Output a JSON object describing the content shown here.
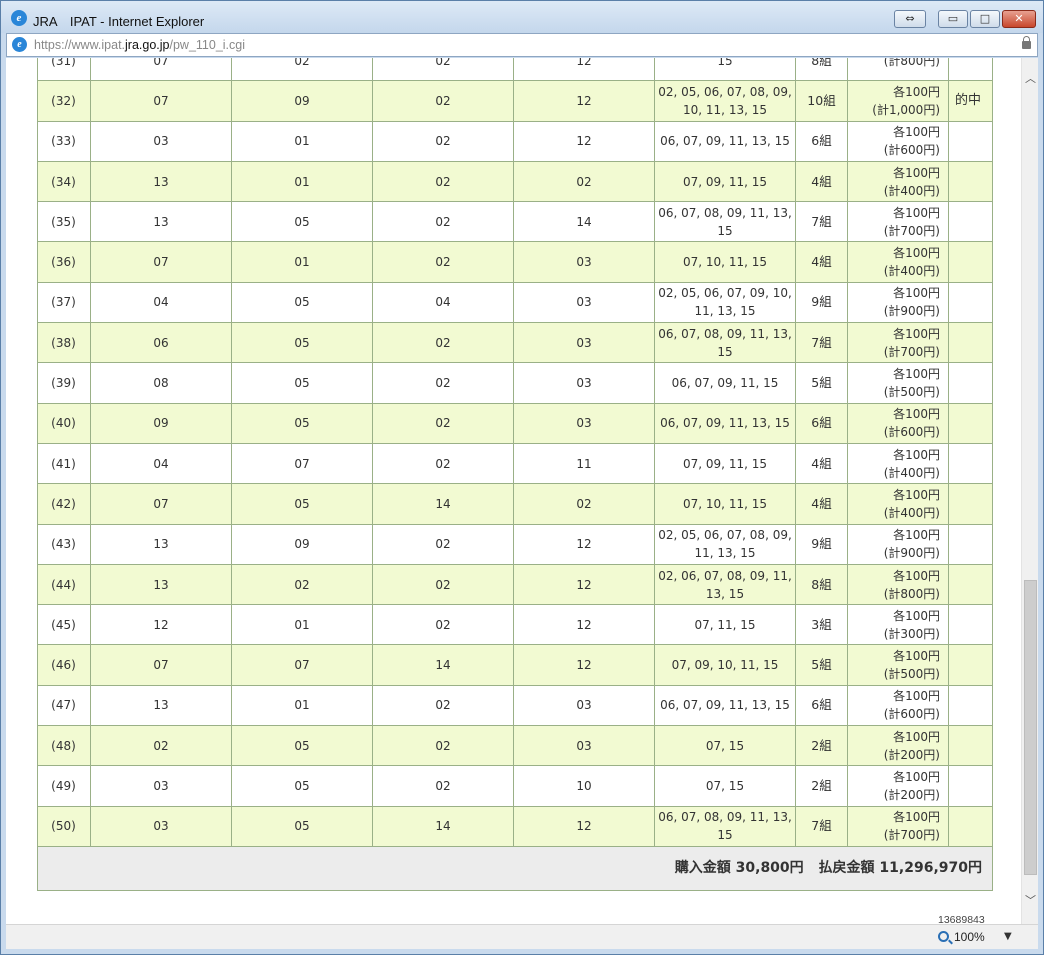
{
  "window": {
    "title": "JRA　IPAT - Internet Explorer",
    "ie_logo_glyph": "e",
    "minimize_glyph": "▭",
    "maximize_glyph": "□",
    "close_glyph": "✕",
    "tab_restore_glyph": "⇔"
  },
  "address": {
    "prefix": "https://www.ipat.",
    "host": "jra.go.jp",
    "path": "/pw_110_i.cgi"
  },
  "rows": [
    {
      "no": "(31)",
      "a": "07",
      "b": "02",
      "c": "02",
      "d": "12",
      "horses": "15",
      "kumi": "8組",
      "amt1": "",
      "amt2": "(計800円)",
      "result": "",
      "alt": false
    },
    {
      "no": "(32)",
      "a": "07",
      "b": "09",
      "c": "02",
      "d": "12",
      "horses": "02, 05, 06, 07, 08, 09, 10, 11, 13, 15",
      "kumi": "10組",
      "amt1": "各100円",
      "amt2": "(計1,000円)",
      "result": "的中",
      "alt": true
    },
    {
      "no": "(33)",
      "a": "03",
      "b": "01",
      "c": "02",
      "d": "12",
      "horses": "06, 07, 09, 11, 13, 15",
      "kumi": "6組",
      "amt1": "各100円",
      "amt2": "(計600円)",
      "result": "",
      "alt": false
    },
    {
      "no": "(34)",
      "a": "13",
      "b": "01",
      "c": "02",
      "d": "02",
      "horses": "07, 09, 11, 15",
      "kumi": "4組",
      "amt1": "各100円",
      "amt2": "(計400円)",
      "result": "",
      "alt": true
    },
    {
      "no": "(35)",
      "a": "13",
      "b": "05",
      "c": "02",
      "d": "14",
      "horses": "06, 07, 08, 09, 11, 13, 15",
      "kumi": "7組",
      "amt1": "各100円",
      "amt2": "(計700円)",
      "result": "",
      "alt": false
    },
    {
      "no": "(36)",
      "a": "07",
      "b": "01",
      "c": "02",
      "d": "03",
      "horses": "07, 10, 11, 15",
      "kumi": "4組",
      "amt1": "各100円",
      "amt2": "(計400円)",
      "result": "",
      "alt": true
    },
    {
      "no": "(37)",
      "a": "04",
      "b": "05",
      "c": "04",
      "d": "03",
      "horses": "02, 05, 06, 07, 09, 10, 11, 13, 15",
      "kumi": "9組",
      "amt1": "各100円",
      "amt2": "(計900円)",
      "result": "",
      "alt": false
    },
    {
      "no": "(38)",
      "a": "06",
      "b": "05",
      "c": "02",
      "d": "03",
      "horses": "06, 07, 08, 09, 11, 13, 15",
      "kumi": "7組",
      "amt1": "各100円",
      "amt2": "(計700円)",
      "result": "",
      "alt": true
    },
    {
      "no": "(39)",
      "a": "08",
      "b": "05",
      "c": "02",
      "d": "03",
      "horses": "06, 07, 09, 11, 15",
      "kumi": "5組",
      "amt1": "各100円",
      "amt2": "(計500円)",
      "result": "",
      "alt": false
    },
    {
      "no": "(40)",
      "a": "09",
      "b": "05",
      "c": "02",
      "d": "03",
      "horses": "06, 07, 09, 11, 13, 15",
      "kumi": "6組",
      "amt1": "各100円",
      "amt2": "(計600円)",
      "result": "",
      "alt": true
    },
    {
      "no": "(41)",
      "a": "04",
      "b": "07",
      "c": "02",
      "d": "11",
      "horses": "07, 09, 11, 15",
      "kumi": "4組",
      "amt1": "各100円",
      "amt2": "(計400円)",
      "result": "",
      "alt": false
    },
    {
      "no": "(42)",
      "a": "07",
      "b": "05",
      "c": "14",
      "d": "02",
      "horses": "07, 10, 11, 15",
      "kumi": "4組",
      "amt1": "各100円",
      "amt2": "(計400円)",
      "result": "",
      "alt": true
    },
    {
      "no": "(43)",
      "a": "13",
      "b": "09",
      "c": "02",
      "d": "12",
      "horses": "02, 05, 06, 07, 08, 09, 11, 13, 15",
      "kumi": "9組",
      "amt1": "各100円",
      "amt2": "(計900円)",
      "result": "",
      "alt": false
    },
    {
      "no": "(44)",
      "a": "13",
      "b": "02",
      "c": "02",
      "d": "12",
      "horses": "02, 06, 07, 08, 09, 11, 13, 15",
      "kumi": "8組",
      "amt1": "各100円",
      "amt2": "(計800円)",
      "result": "",
      "alt": true
    },
    {
      "no": "(45)",
      "a": "12",
      "b": "01",
      "c": "02",
      "d": "12",
      "horses": "07, 11, 15",
      "kumi": "3組",
      "amt1": "各100円",
      "amt2": "(計300円)",
      "result": "",
      "alt": false
    },
    {
      "no": "(46)",
      "a": "07",
      "b": "07",
      "c": "14",
      "d": "12",
      "horses": "07, 09, 10, 11, 15",
      "kumi": "5組",
      "amt1": "各100円",
      "amt2": "(計500円)",
      "result": "",
      "alt": true
    },
    {
      "no": "(47)",
      "a": "13",
      "b": "01",
      "c": "02",
      "d": "03",
      "horses": "06, 07, 09, 11, 13, 15",
      "kumi": "6組",
      "amt1": "各100円",
      "amt2": "(計600円)",
      "result": "",
      "alt": false
    },
    {
      "no": "(48)",
      "a": "02",
      "b": "05",
      "c": "02",
      "d": "03",
      "horses": "07, 15",
      "kumi": "2組",
      "amt1": "各100円",
      "amt2": "(計200円)",
      "result": "",
      "alt": true
    },
    {
      "no": "(49)",
      "a": "03",
      "b": "05",
      "c": "02",
      "d": "10",
      "horses": "07, 15",
      "kumi": "2組",
      "amt1": "各100円",
      "amt2": "(計200円)",
      "result": "",
      "alt": false
    },
    {
      "no": "(50)",
      "a": "03",
      "b": "05",
      "c": "14",
      "d": "12",
      "horses": "06, 07, 08, 09, 11, 13, 15",
      "kumi": "7組",
      "amt1": "各100円",
      "amt2": "(計700円)",
      "result": "",
      "alt": true
    }
  ],
  "totals": {
    "purchase_label": "購入金額",
    "purchase_value": "30,800円",
    "payout_label": "払戻金額",
    "payout_value": "11,296,970円"
  },
  "footer_id": "13689843",
  "scrollbar": {
    "up": "︿",
    "down": "﹀"
  },
  "status": {
    "zoom": "100%",
    "zoom_arrow": "▼"
  },
  "colors": {
    "row_alt": "#f2fad2",
    "border": "#9ab087",
    "totals_bg": "#ececec"
  }
}
